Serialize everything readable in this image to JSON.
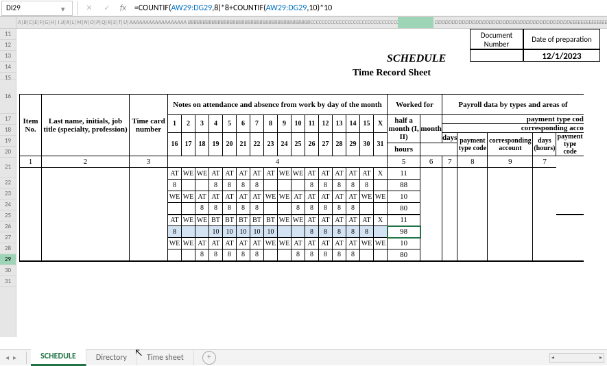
{
  "name_box": "DI29",
  "formula": {
    "prefix": "=COUNTIF(",
    "ref1": "AW29:DG29",
    "mid1": ",8)*8+COUNTIF(",
    "ref2": "AW29:DG29",
    "suffix": ",10)*10"
  },
  "col_header_text": "A|B|C|E|F|G|H|  I JJ|K|L|M|N|O|P|Q|R|S|T|U|AAAAAAAAAAAAAAAAAA BBBBBBBBBBBBBBBBBBBBBBBBBBBBBBBBBBBBBBBBBCCCCCCCCCCCCCCCCCCCCCCCCCCCCCCCCCCCCCCCCCCCCCCCCDDDDDDDD",
  "col_header_tail": "DDDDDDDDDDDDDDDDDDDDDDDDDDDDDDDDDDDDDDDDEEEEEEEEEEEEEEEEEEEE",
  "row_numbers": [
    "11",
    "12",
    "13",
    "14",
    "15",
    "16",
    "17",
    "18",
    "19",
    "20",
    "21",
    "22",
    "23",
    "24",
    "25",
    "26",
    "27",
    "28",
    "29",
    "30",
    "31"
  ],
  "doc_info": {
    "doc_number_label": "Document Number",
    "prep_date_label": "Date of preparation",
    "prep_date_value": "12/1/2023"
  },
  "schedule_title": "SCHEDULE",
  "subtitle": "Time Record Sheet",
  "headers": {
    "item_no": "Item No.",
    "name_job": "Last name, initials, job title (specialty, profession)",
    "timecard": "Time card number",
    "notes": "Notes on attendance and absence from work by day of the month",
    "worked_for": "Worked for",
    "half_month": "half a month (I, II)",
    "month": "month",
    "days": "days",
    "hours": "hours",
    "payroll": "Payroll data\nby types and areas of",
    "payment_type_cod": "payment type cod",
    "corr_acc": "corresponding acco",
    "pay_type_code": "payment type code",
    "corr_account": "corresponding account",
    "days_hours": "days (hours)",
    "pay_type_code2": "payment type code"
  },
  "day_labels_1": [
    "1",
    "2",
    "3",
    "4",
    "5",
    "6",
    "7",
    "8",
    "9",
    "10",
    "11",
    "12",
    "13",
    "14",
    "15",
    "X"
  ],
  "day_labels_2": [
    "16",
    "17",
    "18",
    "19",
    "20",
    "21",
    "22",
    "23",
    "24",
    "25",
    "26",
    "27",
    "28",
    "29",
    "30",
    "31"
  ],
  "col_numbers": {
    "c1": "1",
    "c2": "2",
    "c3": "3",
    "c4": "4",
    "c5": "5",
    "c6": "6",
    "c7": "7",
    "c8": "8",
    "c9": "9",
    "c7b": "7"
  },
  "rows": {
    "r24": [
      "AT",
      "WE",
      "WE",
      "AT",
      "AT",
      "AT",
      "AT",
      "AT",
      "WE",
      "WE",
      "AT",
      "AT",
      "AT",
      "AT",
      "AT",
      "X"
    ],
    "r24_worked": "11",
    "r25": [
      "8",
      "",
      "",
      "8",
      "8",
      "8",
      "8",
      "",
      "",
      "",
      "8",
      "8",
      "8",
      "8",
      "8",
      ""
    ],
    "r25_worked": "88",
    "r26": [
      "WE",
      "WE",
      "AT",
      "AT",
      "AT",
      "AT",
      "AT",
      "WE",
      "WE",
      "AT",
      "AT",
      "AT",
      "AT",
      "AT",
      "WE",
      "WE"
    ],
    "r26_worked": "10",
    "r27": [
      "",
      "",
      "8",
      "8",
      "8",
      "8",
      "8",
      "",
      "",
      "8",
      "8",
      "8",
      "8",
      "8",
      "",
      ""
    ],
    "r27_worked": "80",
    "r28": [
      "AT",
      "WE",
      "WE",
      "BT",
      "BT",
      "BT",
      "BT",
      "BT",
      "WE",
      "WE",
      "AT",
      "AT",
      "AT",
      "AT",
      "AT",
      "X"
    ],
    "r28_worked": "11",
    "r29": [
      "8",
      "",
      "",
      "10",
      "10",
      "10",
      "10",
      "10",
      "",
      "",
      "8",
      "8",
      "8",
      "8",
      "8",
      ""
    ],
    "r29_worked": "98",
    "r30": [
      "WE",
      "WE",
      "AT",
      "AT",
      "AT",
      "AT",
      "AT",
      "WE",
      "WE",
      "AT",
      "AT",
      "AT",
      "AT",
      "AT",
      "WE",
      "WE"
    ],
    "r30_worked": "10",
    "r31": [
      "",
      "",
      "8",
      "8",
      "8",
      "8",
      "8",
      "",
      "",
      "8",
      "8",
      "8",
      "8",
      "8",
      "",
      ""
    ],
    "r31_worked": "80"
  },
  "tabs": {
    "t1": "SCHEDULE",
    "t2": "Directory",
    "t3": "Time sheet"
  }
}
